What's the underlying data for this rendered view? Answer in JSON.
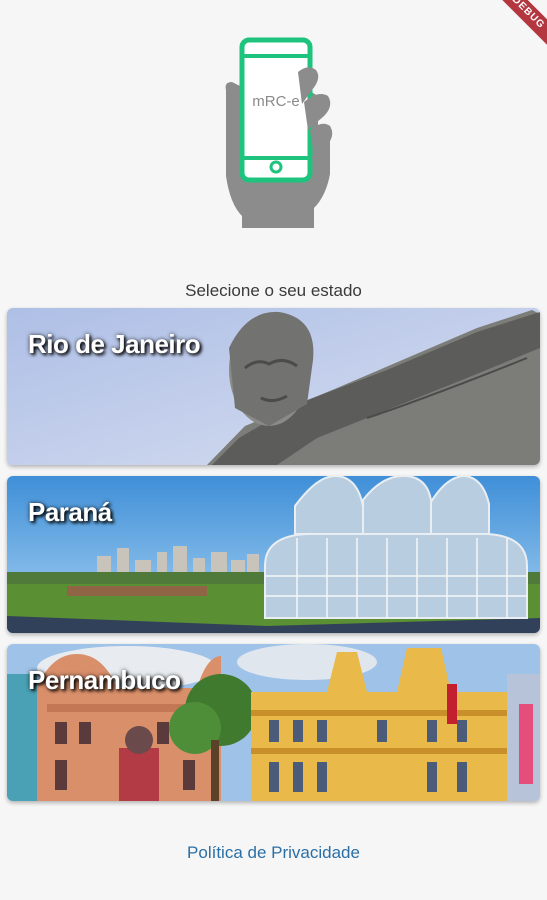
{
  "debug_banner": "DEBUG",
  "logo": {
    "text": "mRC-e",
    "icon": "hand-holding-phone-icon"
  },
  "subtitle": "Selecione o seu estado",
  "states": [
    {
      "label": "Rio de Janeiro"
    },
    {
      "label": "Paraná"
    },
    {
      "label": "Pernambuco"
    }
  ],
  "privacy_link": "Política de Privacidade",
  "colors": {
    "accent": "#1ec47d",
    "link": "#2a6fa6",
    "background": "#f6f6f7"
  }
}
